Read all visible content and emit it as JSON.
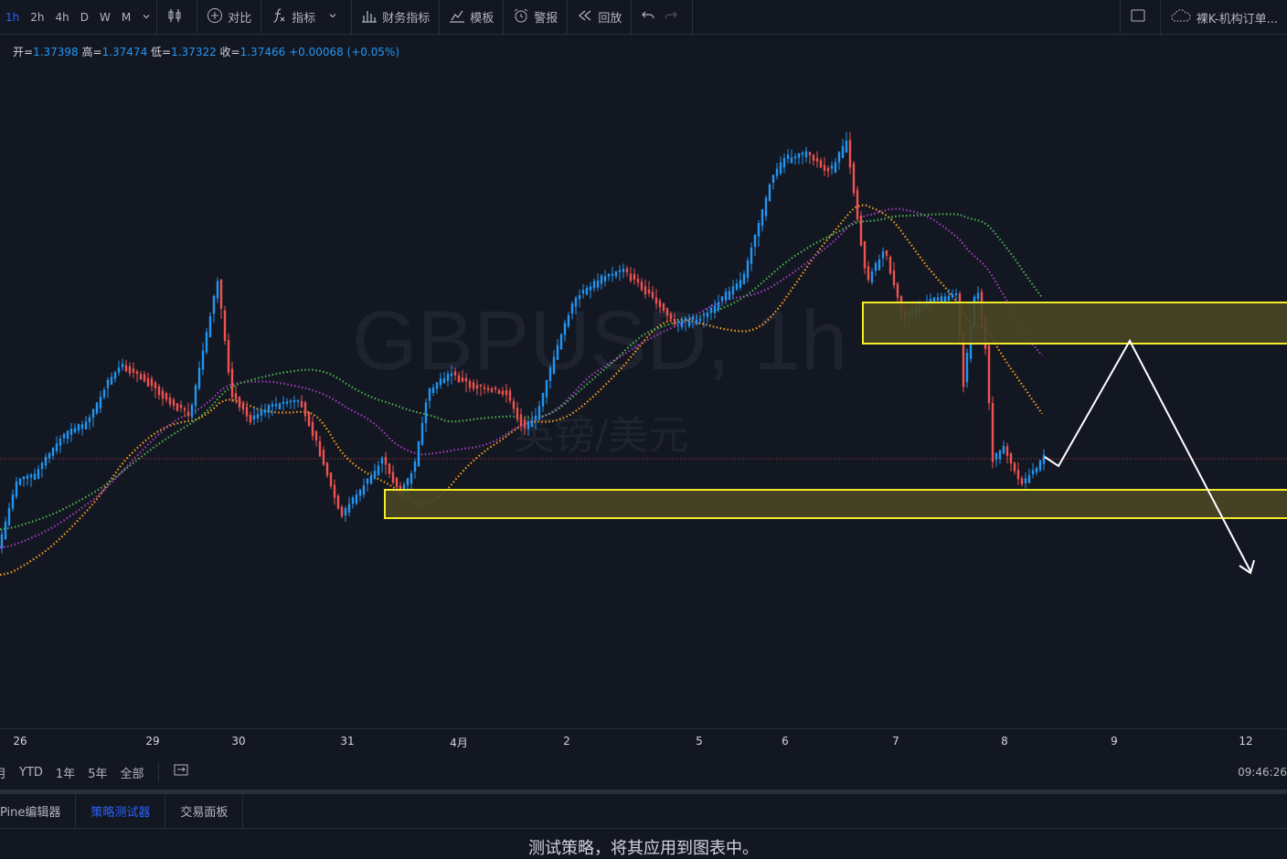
{
  "toolbar": {
    "timeframes": [
      "1h",
      "2h",
      "4h",
      "D",
      "W",
      "M"
    ],
    "active_timeframe": "1h",
    "compare_label": "对比",
    "indicators_label": "指标",
    "financials_label": "财务指标",
    "templates_label": "模板",
    "alert_label": "警报",
    "replay_label": "回放",
    "layout_label": "裸K-机构订单..."
  },
  "ohlc": {
    "open_label": "开=",
    "open": "1.37398",
    "high_label": "高=",
    "high": "1.37474",
    "low_label": "低=",
    "low": "1.37322",
    "close_label": "收=",
    "close": "1.37466",
    "change": "+0.00068 (+0.05%)"
  },
  "watermark": {
    "symbol": "GBPUSD, 1h",
    "description": "英镑/美元"
  },
  "xaxis_labels": [
    "26",
    "29",
    "30",
    "31",
    "4月",
    "2",
    "5",
    "6",
    "7",
    "8",
    "9",
    "12"
  ],
  "ranges": [
    "月",
    "YTD",
    "1年",
    "5年",
    "全部"
  ],
  "clock": "09:46:26",
  "tabs": [
    "Pine编辑器",
    "策略测试器",
    "交易面板"
  ],
  "active_tab": "策略测试器",
  "hint": "测试策略，将其应用到图表中。",
  "colors": {
    "background": "#131722",
    "up": "#2196f3",
    "down": "#ef5350",
    "zone_fill": "#4a4724",
    "zone_border": "#f5eb28",
    "ma_orange": "#f59d1d",
    "ma_purple": "#a23bbd",
    "ma_green": "#4caf50",
    "accent": "#2962ff"
  }
}
